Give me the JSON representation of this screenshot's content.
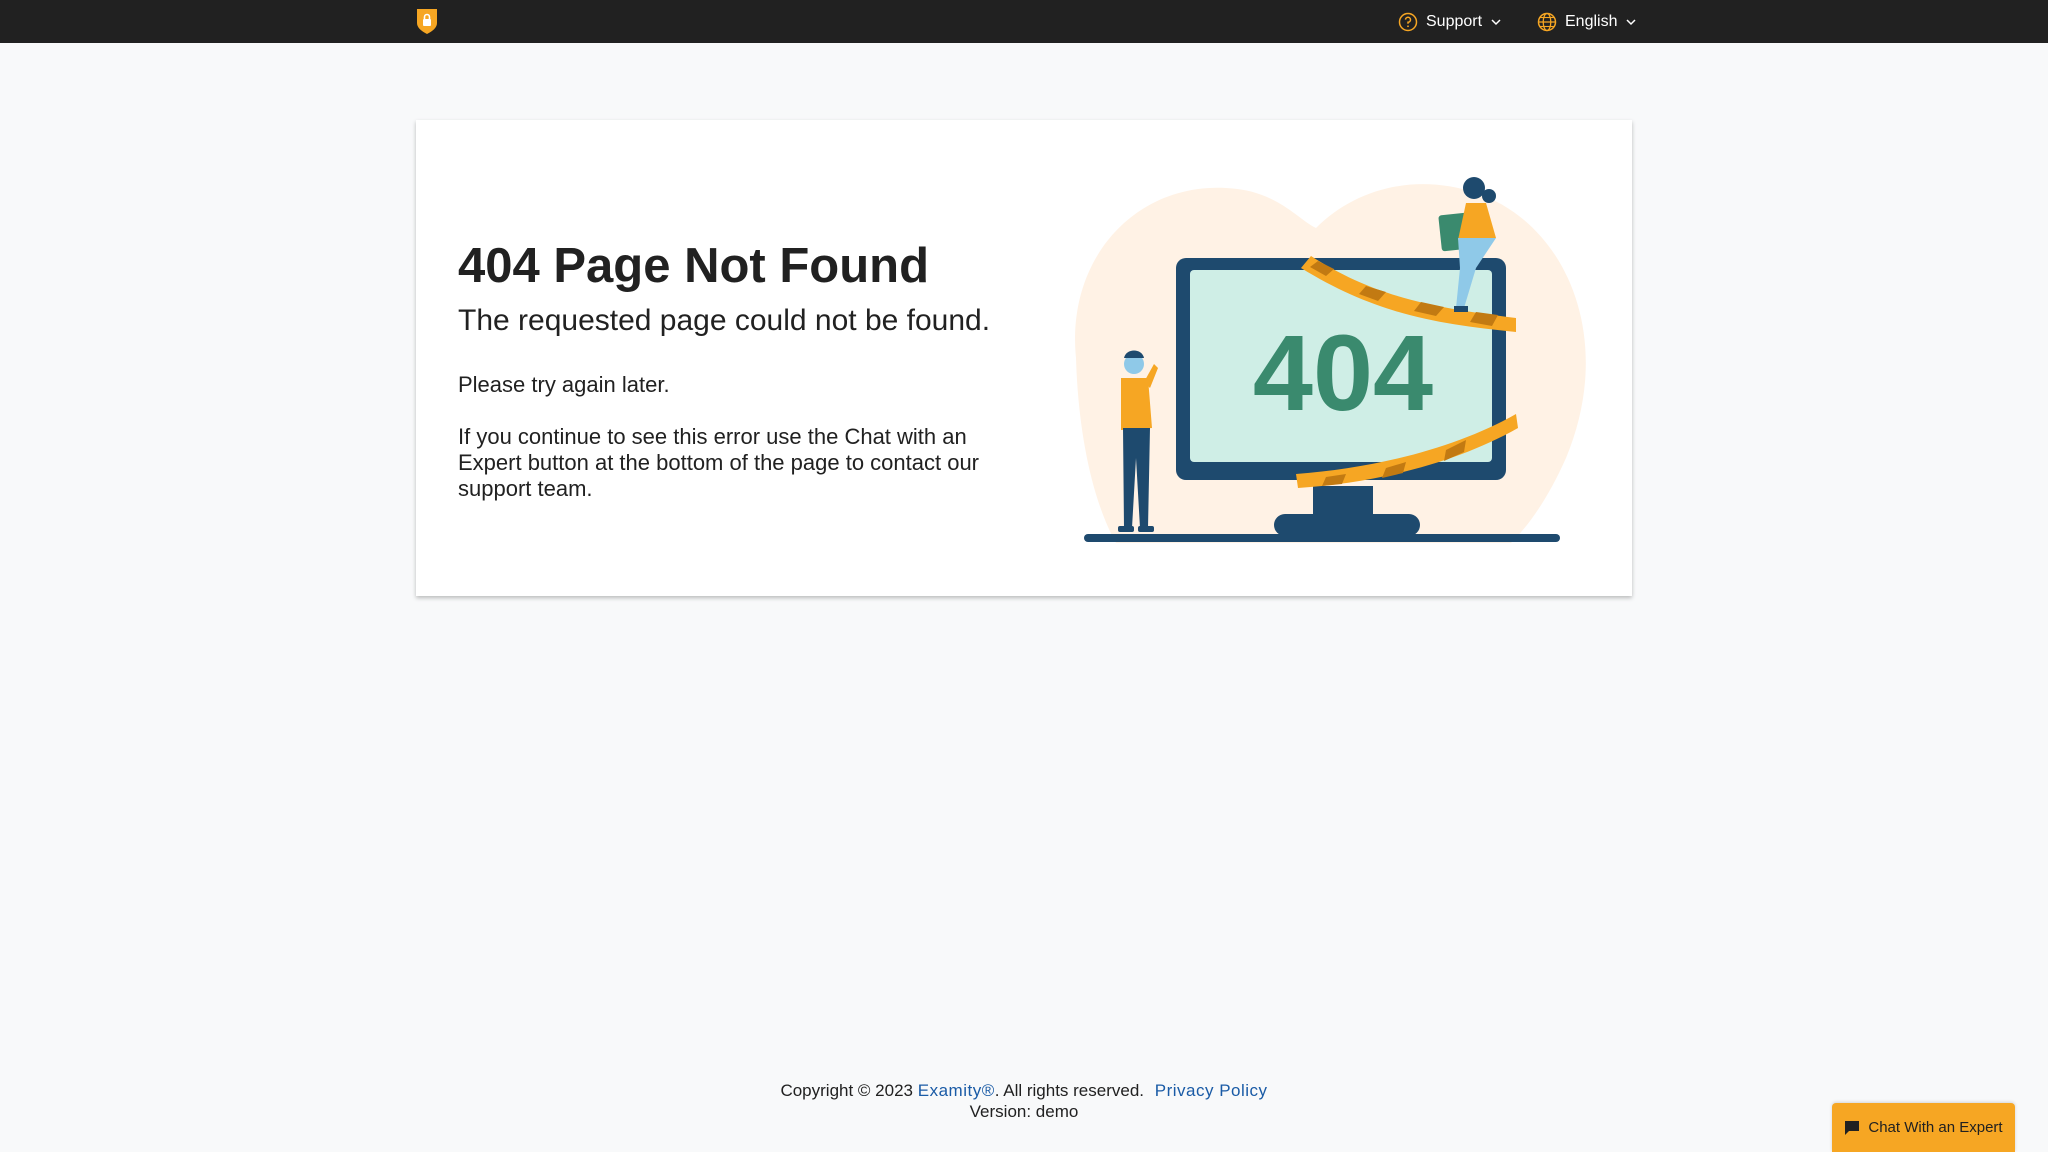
{
  "header": {
    "logo": "shield-lock-logo",
    "support_label": "Support",
    "language_label": "English"
  },
  "error": {
    "title": "404 Page Not Found",
    "subtitle": "The requested page could not be found.",
    "message1": "Please try again later.",
    "message2": "If you continue to see this error use the Chat with an Expert button at the bottom of the page to contact our support team.",
    "illustration_text": "404"
  },
  "footer": {
    "copyright_prefix": "Copyright © 2023",
    "brand_link": "Examity®",
    "rights": ". All rights reserved.",
    "privacy_link": "Privacy Policy",
    "version": "Version: demo"
  },
  "chat": {
    "label": "Chat With an Expert"
  },
  "colors": {
    "topbar": "#212121",
    "accent": "#f6a623",
    "link": "#1a5ba6",
    "monitor": "#1e4a6e",
    "screen": "#cfeee6",
    "digits": "#3a8a6e"
  }
}
